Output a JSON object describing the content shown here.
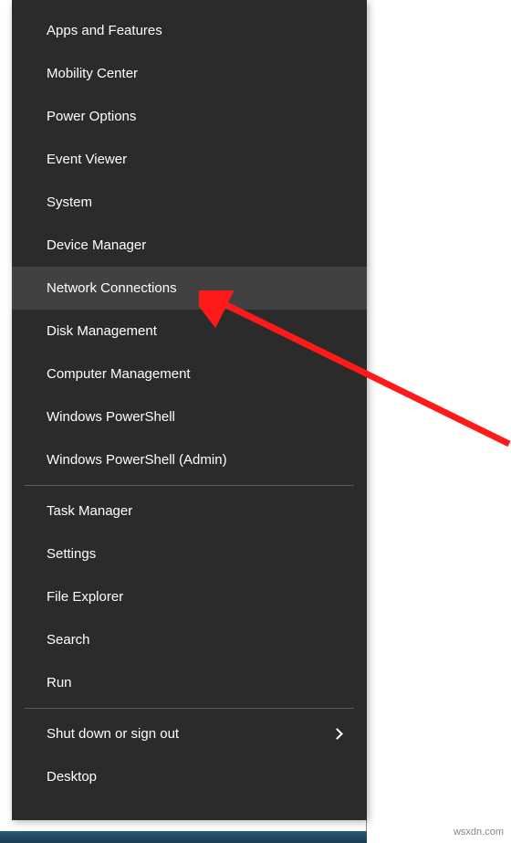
{
  "menu": {
    "groups": [
      {
        "items": [
          {
            "id": "apps-features",
            "label": "Apps and Features",
            "highlighted": false,
            "hasSubmenu": false
          },
          {
            "id": "mobility-center",
            "label": "Mobility Center",
            "highlighted": false,
            "hasSubmenu": false
          },
          {
            "id": "power-options",
            "label": "Power Options",
            "highlighted": false,
            "hasSubmenu": false
          },
          {
            "id": "event-viewer",
            "label": "Event Viewer",
            "highlighted": false,
            "hasSubmenu": false
          },
          {
            "id": "system",
            "label": "System",
            "highlighted": false,
            "hasSubmenu": false
          },
          {
            "id": "device-manager",
            "label": "Device Manager",
            "highlighted": false,
            "hasSubmenu": false
          },
          {
            "id": "network-connections",
            "label": "Network Connections",
            "highlighted": true,
            "hasSubmenu": false
          },
          {
            "id": "disk-management",
            "label": "Disk Management",
            "highlighted": false,
            "hasSubmenu": false
          },
          {
            "id": "computer-management",
            "label": "Computer Management",
            "highlighted": false,
            "hasSubmenu": false
          },
          {
            "id": "windows-powershell",
            "label": "Windows PowerShell",
            "highlighted": false,
            "hasSubmenu": false
          },
          {
            "id": "windows-powershell-admin",
            "label": "Windows PowerShell (Admin)",
            "highlighted": false,
            "hasSubmenu": false
          }
        ]
      },
      {
        "items": [
          {
            "id": "task-manager",
            "label": "Task Manager",
            "highlighted": false,
            "hasSubmenu": false
          },
          {
            "id": "settings",
            "label": "Settings",
            "highlighted": false,
            "hasSubmenu": false
          },
          {
            "id": "file-explorer",
            "label": "File Explorer",
            "highlighted": false,
            "hasSubmenu": false
          },
          {
            "id": "search",
            "label": "Search",
            "highlighted": false,
            "hasSubmenu": false
          },
          {
            "id": "run",
            "label": "Run",
            "highlighted": false,
            "hasSubmenu": false
          }
        ]
      },
      {
        "items": [
          {
            "id": "shut-down",
            "label": "Shut down or sign out",
            "highlighted": false,
            "hasSubmenu": true
          },
          {
            "id": "desktop",
            "label": "Desktop",
            "highlighted": false,
            "hasSubmenu": false
          }
        ]
      }
    ]
  },
  "annotation": {
    "arrow_color": "#ff1a1a"
  },
  "watermark": "wsxdn.com"
}
